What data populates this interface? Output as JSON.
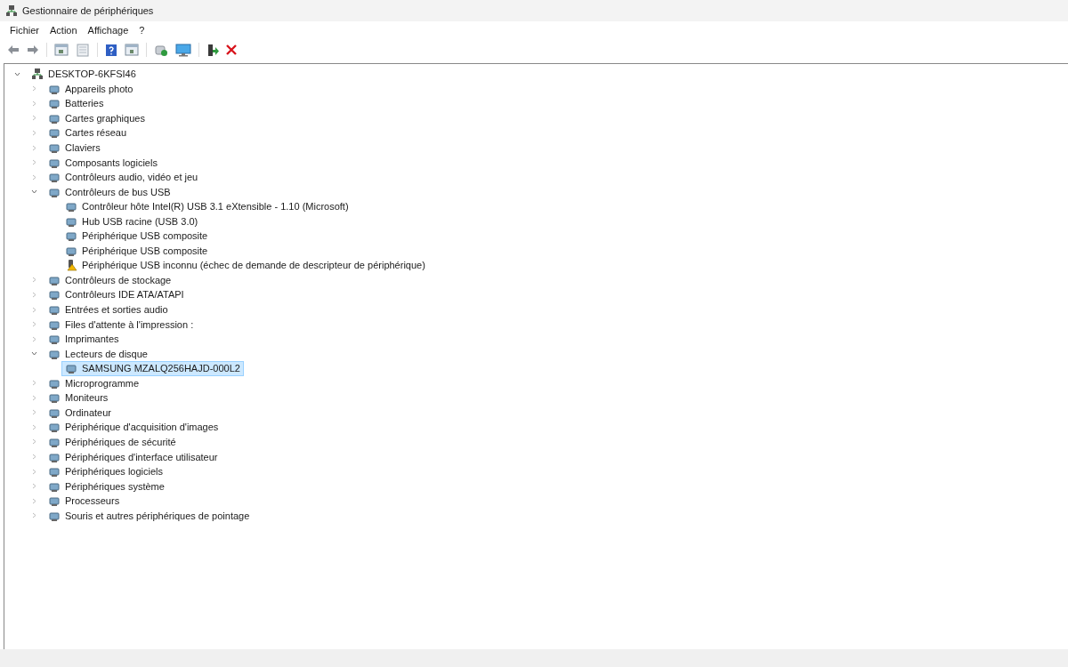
{
  "window": {
    "title": "Gestionnaire de périphériques"
  },
  "menu": [
    "Fichier",
    "Action",
    "Affichage",
    "?"
  ],
  "tree": {
    "label": "DESKTOP-6KFSI46",
    "expanded": true,
    "selected": false,
    "children": [
      {
        "label": "Appareils photo",
        "expanded": false,
        "selected": false
      },
      {
        "label": "Batteries",
        "expanded": false,
        "selected": false
      },
      {
        "label": "Cartes graphiques",
        "expanded": false,
        "selected": false
      },
      {
        "label": "Cartes réseau",
        "expanded": false,
        "selected": false
      },
      {
        "label": "Claviers",
        "expanded": false,
        "selected": false
      },
      {
        "label": "Composants logiciels",
        "expanded": false,
        "selected": false
      },
      {
        "label": "Contrôleurs audio, vidéo et jeu",
        "expanded": false,
        "selected": false
      },
      {
        "label": "Contrôleurs de bus USB",
        "expanded": true,
        "selected": false,
        "children": [
          {
            "label": "Contrôleur hôte Intel(R) USB 3.1 eXtensible - 1.10 (Microsoft)",
            "selected": false,
            "warning": false
          },
          {
            "label": "Hub USB racine (USB 3.0)",
            "selected": false,
            "warning": false
          },
          {
            "label": "Périphérique USB composite",
            "selected": false,
            "warning": false
          },
          {
            "label": "Périphérique USB composite",
            "selected": false,
            "warning": false
          },
          {
            "label": "Périphérique USB inconnu (échec de demande de descripteur de périphérique)",
            "selected": false,
            "warning": true
          }
        ]
      },
      {
        "label": "Contrôleurs de stockage",
        "expanded": false,
        "selected": false
      },
      {
        "label": "Contrôleurs IDE ATA/ATAPI",
        "expanded": false,
        "selected": false
      },
      {
        "label": "Entrées et sorties audio",
        "expanded": false,
        "selected": false
      },
      {
        "label": "Files d'attente à l'impression :",
        "expanded": false,
        "selected": false
      },
      {
        "label": "Imprimantes",
        "expanded": false,
        "selected": false
      },
      {
        "label": "Lecteurs de disque",
        "expanded": true,
        "selected": false,
        "children": [
          {
            "label": "SAMSUNG MZALQ256HAJD-000L2",
            "selected": true,
            "warning": false
          }
        ]
      },
      {
        "label": "Microprogramme",
        "expanded": false,
        "selected": false
      },
      {
        "label": "Moniteurs",
        "expanded": false,
        "selected": false
      },
      {
        "label": "Ordinateur",
        "expanded": false,
        "selected": false
      },
      {
        "label": "Périphérique d'acquisition d'images",
        "expanded": false,
        "selected": false
      },
      {
        "label": "Périphériques de sécurité",
        "expanded": false,
        "selected": false
      },
      {
        "label": "Périphériques d'interface utilisateur",
        "expanded": false,
        "selected": false
      },
      {
        "label": "Périphériques logiciels",
        "expanded": false,
        "selected": false
      },
      {
        "label": "Périphériques système",
        "expanded": false,
        "selected": false
      },
      {
        "label": "Processeurs",
        "expanded": false,
        "selected": false
      },
      {
        "label": "Souris et autres périphériques de pointage",
        "expanded": false,
        "selected": false
      }
    ]
  }
}
